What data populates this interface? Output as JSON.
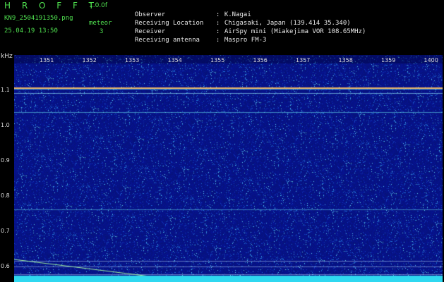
{
  "header": {
    "app_title": "H R O F F T",
    "version": "1.0.0f",
    "file_name": "KN9_2504191350.png",
    "timestamp": "25.04.19 13:50",
    "meteor_label": "meteor",
    "meteor_count": "3"
  },
  "meta": [
    {
      "label": "Observer",
      "value": "K.Nagai"
    },
    {
      "label": "Receiving Location",
      "value": "Chigasaki, Japan (139.414 35.340)"
    },
    {
      "label": "Receiver",
      "value": "AirSpy mini (Miakejima VOR 108.65MHz)"
    },
    {
      "label": "Receiving antenna",
      "value": "Maspro FM-3"
    }
  ],
  "axis": {
    "unit": "kHz",
    "y_ticks": [
      "1.1",
      "1.0",
      "0.9",
      "0.8",
      "0.7",
      "0.6"
    ],
    "x_ticks": [
      "1351",
      "1352",
      "1353",
      "1354",
      "1355",
      "1356",
      "1357",
      "1358",
      "1359",
      "1400"
    ]
  },
  "colors": {
    "background": "#000000",
    "spectrogram_base": "#0a1a8a",
    "header_green": "#4fe04f",
    "header_text": "#e8e8e8"
  }
}
